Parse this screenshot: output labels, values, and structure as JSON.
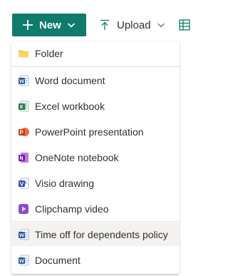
{
  "toolbar": {
    "new_label": "New",
    "upload_label": "Upload",
    "accent": "#0f7b6c"
  },
  "menu": {
    "items": [
      {
        "label": "Folder",
        "icon": "folder-icon"
      },
      {
        "label": "Word document",
        "icon": "word-icon"
      },
      {
        "label": "Excel workbook",
        "icon": "excel-icon"
      },
      {
        "label": "PowerPoint presentation",
        "icon": "powerpoint-icon"
      },
      {
        "label": "OneNote notebook",
        "icon": "onenote-icon"
      },
      {
        "label": "Visio drawing",
        "icon": "visio-icon"
      },
      {
        "label": "Clipchamp video",
        "icon": "clipchamp-icon"
      },
      {
        "label": "Time off for dependents policy",
        "icon": "word-template-icon",
        "hovered": true
      },
      {
        "label": "Document",
        "icon": "word-template-icon"
      }
    ]
  },
  "colors": {
    "word": "#2b579a",
    "excel": "#217346",
    "powerpoint": "#c43e1c",
    "onenote": "#7719aa",
    "visio": "#3955a3",
    "clipchamp": "#8a4bd6",
    "folder": "#f6c343"
  }
}
